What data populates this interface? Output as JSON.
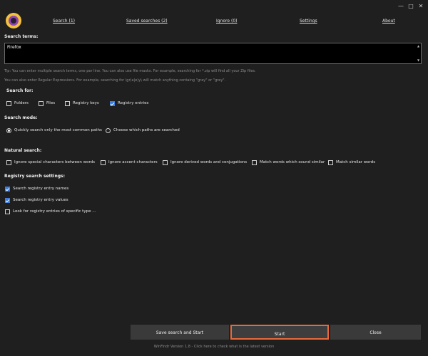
{
  "window": {
    "minimize_glyph": "—",
    "maximize_glyph": "□",
    "close_glyph": "✕"
  },
  "nav": {
    "items": [
      {
        "label": "Search (1)"
      },
      {
        "label": "Saved searches (2)"
      },
      {
        "label": "Ignore (0)"
      },
      {
        "label": "Settings"
      },
      {
        "label": "About"
      }
    ]
  },
  "search_terms": {
    "label": "Search terms:",
    "value": "Firefox",
    "tip1": "Tip: You can enter multiple search terms, one per line. You can also use file masks. For example, searching for *.zip will find all your Zip files.",
    "tip2": "You can also enter Regular Expressions. For example, searching for \\gr(a|e)y\\ will match anything containg \"gray\" or \"grey\"."
  },
  "search_for": {
    "label": "Search for:",
    "options": [
      {
        "label": "Folders",
        "checked": false
      },
      {
        "label": "Files",
        "checked": false
      },
      {
        "label": "Registry keys",
        "checked": false
      },
      {
        "label": "Registry entries",
        "checked": true
      }
    ]
  },
  "search_mode": {
    "label": "Search mode:",
    "options": [
      {
        "label": "Quickly search only the most common paths",
        "selected": true
      },
      {
        "label": "Choose which paths are searched",
        "selected": false
      }
    ]
  },
  "natural_search": {
    "label": "Natural search:",
    "options": [
      {
        "label": "Ignore special characters between words",
        "checked": false
      },
      {
        "label": "Ignore accent characters",
        "checked": false
      },
      {
        "label": "Ignore derived words and conjugations",
        "checked": false
      },
      {
        "label": "Match words which sound similar",
        "checked": false
      },
      {
        "label": "Match similar words",
        "checked": false
      }
    ]
  },
  "registry_settings": {
    "label": "Registry search settings:",
    "options": [
      {
        "label": "Search registry entry names",
        "checked": true
      },
      {
        "label": "Search registry entry values",
        "checked": true
      },
      {
        "label": "Look for registry entries of specific type ...",
        "checked": false
      }
    ]
  },
  "buttons": {
    "save_start": "Save search and Start",
    "start": "Start",
    "close": "Close"
  },
  "footer": "WinFindr Version 1.8 - Click here to check what is the latest version",
  "colors": {
    "background": "#1f1f1f",
    "accent_border": "#e86a3a",
    "checkbox_checked": "#3b7ee0",
    "logo_outer": "#f4c23a",
    "logo_inner": "#8d44b8"
  }
}
